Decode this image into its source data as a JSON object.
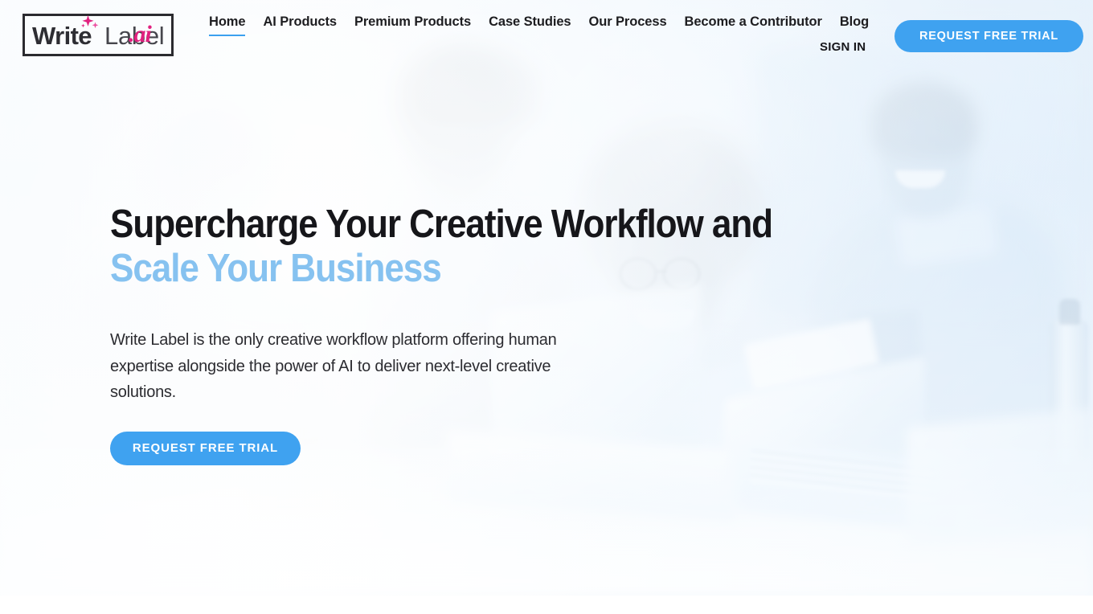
{
  "brand": {
    "logo_write": "Write",
    "logo_label": "Label",
    "logo_tld": ".ai",
    "accent_blue": "#3fa2f0",
    "accent_pink": "#e1217f",
    "title_dark": "#16161a",
    "title_light_blue": "#86c2f0"
  },
  "header": {
    "nav": [
      {
        "label": "Home",
        "active": true
      },
      {
        "label": "AI Products",
        "active": false
      },
      {
        "label": "Premium Products",
        "active": false
      },
      {
        "label": "Case Studies",
        "active": false
      },
      {
        "label": "Our Process",
        "active": false
      },
      {
        "label": "Become a Contributor",
        "active": false
      },
      {
        "label": "Blog",
        "active": false
      }
    ],
    "signin_label": "SIGN IN",
    "cta_label": "REQUEST FREE TRIAL"
  },
  "hero": {
    "title_line1": "Supercharge Your Creative Workflow and",
    "title_line2": "Scale Your Business",
    "subtitle": "Write Label is the only creative workflow platform offering human expertise alongside the power of AI to deliver next-level creative solutions.",
    "cta_label": "REQUEST FREE TRIAL",
    "background_description": "Faded blue-tinted photo of a team of people smiling and working together on laptops in a bright office"
  }
}
